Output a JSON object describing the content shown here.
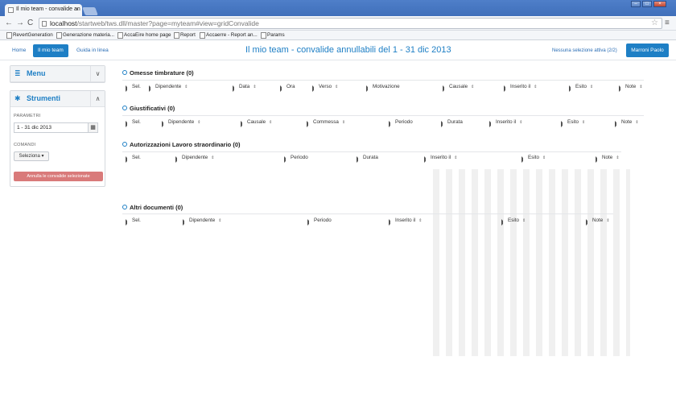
{
  "browser": {
    "tab_title": "Il mio team - convalide an",
    "tab_close": "×",
    "url_host": "localhost",
    "url_path": "/startweb/tws.dll/master?page=myteam#view=gridConvalide",
    "nav_back": "←",
    "nav_forward": "→",
    "nav_reload": "C",
    "star": "☆",
    "menu": "≡",
    "win_min": "–",
    "win_max": "□",
    "win_close": "×",
    "bookmarks": [
      "RevertGeneration",
      "Generazione materia...",
      "AccaEire home page",
      "Report",
      "Accaerre - Report an...",
      "Params"
    ]
  },
  "header": {
    "nav": [
      "Home",
      "Il mio team",
      "Guida in linea"
    ],
    "title": "Il mio team - convalide annullabili del 1 - 31 dic 2013",
    "selection_info": "Nessuna selezione attiva (2/2)",
    "user": "Marroni Paolo"
  },
  "sidebar": {
    "menu_title": "Menu",
    "tools_title": "Strumenti",
    "params_label": "PARAMETRI",
    "date_value": "1 - 31 dic 2013",
    "commands_label": "COMANDI",
    "select_label": "Seleziona ▾",
    "cancel_button": "Annulla le convalide selezionate"
  },
  "icons": {
    "menu": "≣",
    "tools": "✱",
    "chev_down": "∨",
    "chev_up": "∧",
    "calendar": "▦",
    "sort": "⇕"
  },
  "sections": [
    {
      "title": "Omesse timbrature (0)",
      "columns": [
        "Sel.",
        "Dipendente",
        "Data",
        "Ora",
        "Verso",
        "Motivazione",
        "Causale",
        "Inserito il",
        "Esito",
        "Note"
      ]
    },
    {
      "title": "Giustificativi (0)",
      "columns": [
        "Sel.",
        "Dipendente",
        "Causale",
        "Commessa",
        "Periodo",
        "Durata",
        "Inserito il",
        "Esito",
        "Note"
      ]
    },
    {
      "title": "Autorizzazioni Lavoro straordinario (0)",
      "columns": [
        "Sel.",
        "Dipendente",
        "Periodo",
        "Durata",
        "Inserito il",
        "Esito",
        "Note"
      ]
    },
    {
      "title": "Altri documenti (0)",
      "columns": [
        "Sel.",
        "Dipendente",
        "Periodo",
        "Inserito il",
        "Esito",
        "Note"
      ]
    }
  ]
}
